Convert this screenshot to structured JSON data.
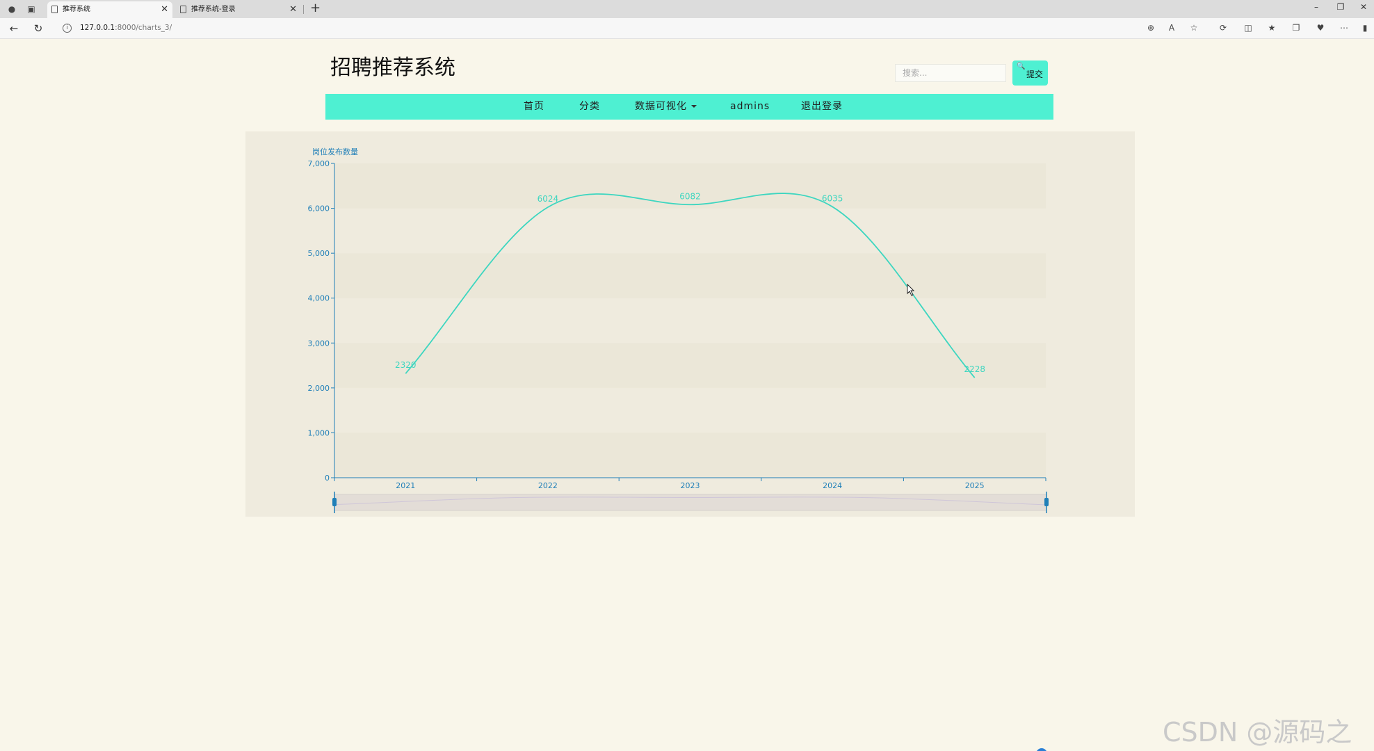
{
  "browser": {
    "tabs": [
      {
        "title": "推荐系统",
        "active": true
      },
      {
        "title": "推荐系统-登录",
        "active": false
      }
    ],
    "url_host": "127.0.0.1",
    "url_rest": ":8000/charts_3/"
  },
  "header": {
    "title": "招聘推荐系统",
    "search_placeholder": "搜索...",
    "submit_label": "提交"
  },
  "nav": {
    "items": [
      "首页",
      "分类",
      "数据可视化",
      "admins",
      "退出登录"
    ]
  },
  "colors": {
    "accent": "#4ef0d2",
    "line": "#3dd6c0",
    "axis": "#1f7fb8",
    "panel": "#efebde",
    "page": "#f9f6ea"
  },
  "chart_data": {
    "type": "line",
    "title": "",
    "ylabel": "岗位发布数量",
    "xlabel": "",
    "categories": [
      "2021",
      "2022",
      "2023",
      "2024",
      "2025"
    ],
    "series": [
      {
        "values": [
          2320,
          6024,
          6082,
          6035,
          2228
        ]
      }
    ],
    "ylim": [
      0,
      7000
    ],
    "yticks": [
      "0",
      "1,000",
      "2,000",
      "3,000",
      "4,000",
      "5,000",
      "6,000",
      "7,000"
    ],
    "smooth": true,
    "data_labels": true,
    "datazoom_slider": true
  },
  "watermark": "CSDN @源码之家"
}
